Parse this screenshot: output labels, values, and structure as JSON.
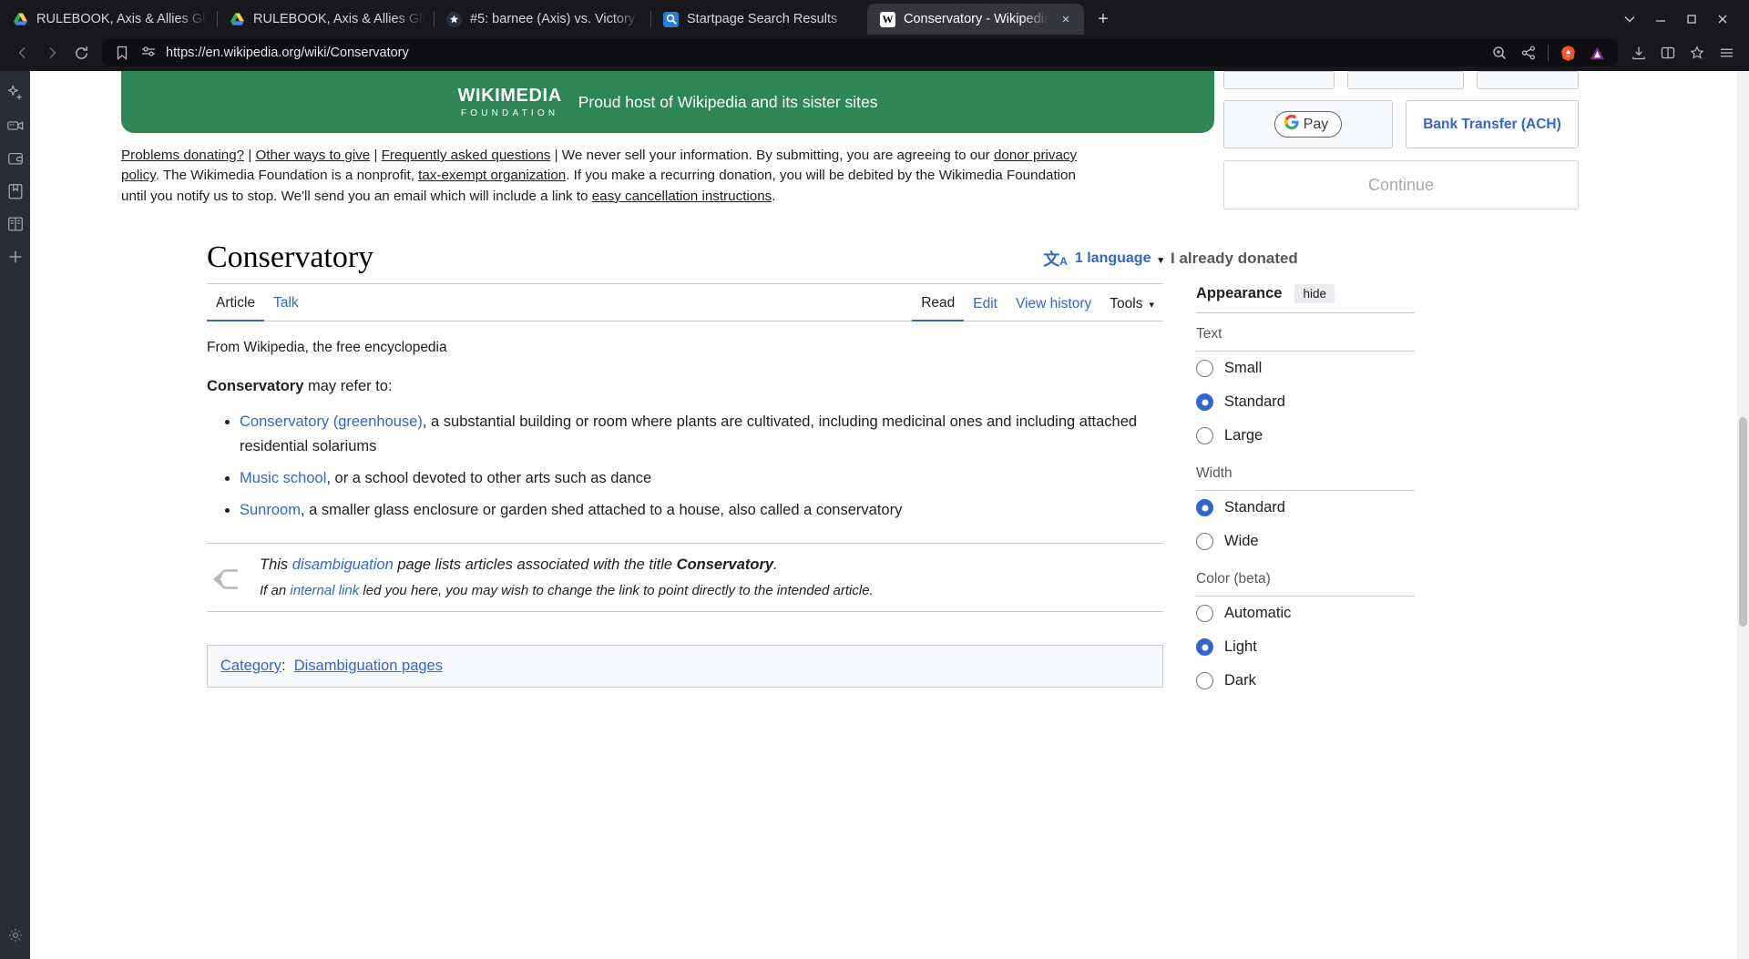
{
  "browser": {
    "tabs": [
      {
        "title": "RULEBOOK, Axis & Allies Glo",
        "favicon": "drive-icon",
        "active": false
      },
      {
        "title": "RULEBOOK, Axis & Allies Glo",
        "favicon": "drive-icon",
        "active": false
      },
      {
        "title": "#5: barnee (Axis) vs. Victory",
        "favicon": "forum-icon",
        "active": false
      },
      {
        "title": "Startpage Search Results",
        "favicon": "startpage-icon",
        "active": false
      },
      {
        "title": "Conservatory - Wikipedia",
        "favicon": "wikipedia-icon",
        "active": true
      }
    ],
    "tab_close_label": "×",
    "new_tab_label": "+",
    "window_controls": {
      "minimize": "—",
      "maximize": "❐",
      "close": "✕",
      "more": "⌄"
    },
    "nav": {
      "back": "back-icon",
      "forward": "forward-icon",
      "reload": "reload-icon",
      "bookmark": "bookmark-icon"
    },
    "url": "https://en.wikipedia.org/wiki/Conservatory",
    "toolbar_right": {
      "zoom": "zoom-in-icon",
      "share": "share-icon",
      "brave_shields": "brave-lion-icon",
      "brave_rewards": "brave-rewards-icon",
      "downloads": "download-icon",
      "split_view": "split-view-icon",
      "bookmarks": "bookmark-star-icon",
      "menu": "hamburger-menu-icon"
    },
    "sidebar_rail": [
      {
        "name": "leo-ai-icon"
      },
      {
        "name": "video-call-icon"
      },
      {
        "name": "wallet-icon"
      },
      {
        "name": "bookmarks-icon"
      },
      {
        "name": "reading-list-icon"
      },
      {
        "name": "add-icon"
      },
      {
        "name": "settings-icon"
      }
    ]
  },
  "banner": {
    "logo_line1": "WIKIMEDIA",
    "logo_line2": "FOUNDATION",
    "tagline": "Proud host of Wikipedia and its sister sites",
    "green_hex": "#2e8555",
    "fineprint": {
      "link1": "Problems donating?",
      "sep1": " | ",
      "link2": "Other ways to give",
      "sep2": " | ",
      "link3": "Frequently asked questions",
      "sep3": " | ",
      "text1": "We never sell your information. By submitting, you are agreeing to our ",
      "link4": "donor privacy policy",
      "text2": ". The Wikimedia Foundation is a nonprofit, ",
      "link5": "tax-exempt organization",
      "text3": ". If you make a recurring donation, you will be debited by the Wikimedia Foundation until you notify us to stop. We'll send you an email which will include a link to ",
      "link6": "easy cancellation instructions",
      "text4": "."
    },
    "already_donated": "I already donated",
    "gpay_label": "Pay",
    "bank_transfer_label": "Bank Transfer (ACH)",
    "continue_label": "Continue"
  },
  "article": {
    "title": "Conservatory",
    "language_button": {
      "count_label": "1 language",
      "glyph": "language-icon"
    },
    "namespace_tabs": [
      {
        "label": "Article",
        "selected": true
      },
      {
        "label": "Talk",
        "selected": false
      }
    ],
    "view_tabs": [
      {
        "label": "Read",
        "selected": true
      },
      {
        "label": "Edit",
        "selected": false
      },
      {
        "label": "View history",
        "selected": false
      }
    ],
    "tools_label": "Tools",
    "from_wikipedia": "From Wikipedia, the free encyclopedia",
    "intro_bold": "Conservatory",
    "intro_rest": " may refer to:",
    "items": [
      {
        "link": "Conservatory (greenhouse)",
        "text": ", a substantial building or room where plants are cultivated, including medicinal ones and including attached residential solariums"
      },
      {
        "link": "Music school",
        "text": ", or a school devoted to other arts such as dance"
      },
      {
        "link": "Sunroom",
        "text": ", a smaller glass enclosure or garden shed attached to a house, also called a conservatory"
      }
    ],
    "dab_note": {
      "line1_a": "This ",
      "line1_link": "disambiguation",
      "line1_b": " page lists articles associated with the title ",
      "line1_bold": "Conservatory",
      "line1_c": ".",
      "line2_a": "If an ",
      "line2_link": "internal link",
      "line2_b": " led you here, you may wish to change the link to point directly to the intended article."
    },
    "category": {
      "label": "Category",
      "colon": ":",
      "value": "Disambiguation pages"
    }
  },
  "appearance": {
    "title": "Appearance",
    "hide_label": "hide",
    "groups": [
      {
        "label": "Text",
        "options": [
          {
            "label": "Small",
            "selected": false
          },
          {
            "label": "Standard",
            "selected": true
          },
          {
            "label": "Large",
            "selected": false
          }
        ]
      },
      {
        "label": "Width",
        "options": [
          {
            "label": "Standard",
            "selected": true
          },
          {
            "label": "Wide",
            "selected": false
          }
        ]
      },
      {
        "label": "Color (beta)",
        "options": [
          {
            "label": "Automatic",
            "selected": false
          },
          {
            "label": "Light",
            "selected": true
          },
          {
            "label": "Dark",
            "selected": false
          }
        ]
      }
    ],
    "accent_hex": "#3366cc"
  }
}
